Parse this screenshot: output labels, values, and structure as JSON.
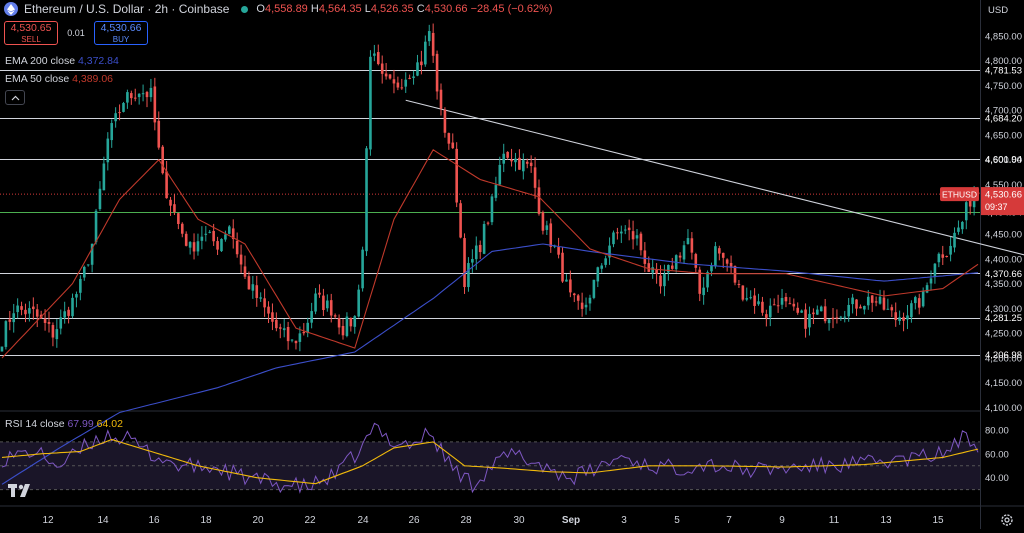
{
  "header": {
    "title": "Ethereum / U.S. Dollar · 2h · Coinbase",
    "open_label": "O",
    "open": "4,558.89",
    "high_label": "H",
    "high": "4,564.35",
    "low_label": "L",
    "low": "4,526.35",
    "close_label": "C",
    "close": "4,530.66",
    "change": "−28.45 (−0.62%)"
  },
  "trade": {
    "sell_price": "4,530.65",
    "sell_label": "SELL",
    "spread": "0.01",
    "buy_price": "4,530.66",
    "buy_label": "BUY"
  },
  "indicators": {
    "ema200_name": "EMA 200 close",
    "ema200_value": "4,372.84",
    "ema50_name": "EMA 50 close",
    "ema50_value": "4,389.06",
    "rsi_name": "RSI 14 close",
    "rsi_value": "67.99",
    "rsi_ma_value": "64.02"
  },
  "currency": "USD",
  "ticker_tag": {
    "symbol": "ETHUSD",
    "price": "4,530.66",
    "countdown": "09:37"
  },
  "colors": {
    "up": "#26a69a",
    "down": "#ef5350",
    "ema200": "#3b4ec9",
    "ema50": "#c0392b",
    "rsi": "#7e57c2",
    "rsi_ma": "#f0b90b",
    "tag": "#d63a3a"
  },
  "chart_data": {
    "type": "candlestick",
    "y_ticks": [
      4100,
      4150,
      4200,
      4250,
      4300,
      4350,
      4400,
      4450,
      4500,
      4550,
      4600,
      4650,
      4700,
      4750,
      4800,
      4850
    ],
    "y_tick_labels": [
      "4,100.00",
      "4,150.00",
      "4,200.00",
      "4,250.00",
      "4,300.00",
      "4,350.00",
      "4,400.00",
      "4,450.00",
      "4,500.00",
      "4,550.00",
      "4,600.00",
      "4,650.00",
      "4,700.00",
      "4,750.00",
      "4,800.00",
      "4,850.00"
    ],
    "ylim": [
      4095,
      4890
    ],
    "x_labels": [
      "12",
      "14",
      "16",
      "18",
      "20",
      "22",
      "24",
      "26",
      "28",
      "30",
      "Sep",
      "3",
      "5",
      "7",
      "9",
      "11",
      "13",
      "15"
    ],
    "horizontal_levels": [
      {
        "value": 4781.53,
        "label": "4,781.53"
      },
      {
        "value": 4684.2,
        "label": "4,684.20"
      },
      {
        "value": 4601.94,
        "label": "4,601.94"
      },
      {
        "value": 4494.94,
        "label": "4,494.94"
      },
      {
        "value": 4370.66,
        "label": "4,370.66"
      },
      {
        "value": 4281.25,
        "label": "4,281.25"
      },
      {
        "value": 4206.98,
        "label": "4,206.98"
      }
    ],
    "price_anchors": [
      [
        0,
        4240
      ],
      [
        3,
        4300
      ],
      [
        8,
        4290
      ],
      [
        13,
        4250
      ],
      [
        17,
        4300
      ],
      [
        20,
        4345
      ],
      [
        23,
        4430
      ],
      [
        27,
        4640
      ],
      [
        31,
        4720
      ],
      [
        35,
        4740
      ],
      [
        38,
        4730
      ],
      [
        41,
        4560
      ],
      [
        45,
        4470
      ],
      [
        48,
        4420
      ],
      [
        51,
        4450
      ],
      [
        55,
        4430
      ],
      [
        58,
        4470
      ],
      [
        62,
        4360
      ],
      [
        66,
        4310
      ],
      [
        70,
        4260
      ],
      [
        74,
        4230
      ],
      [
        77,
        4255
      ],
      [
        80,
        4320
      ],
      [
        84,
        4300
      ],
      [
        87,
        4260
      ],
      [
        90,
        4280
      ],
      [
        92,
        4420
      ],
      [
        94,
        4820
      ],
      [
        97,
        4760
      ],
      [
        100,
        4745
      ],
      [
        103,
        4770
      ],
      [
        107,
        4800
      ],
      [
        109,
        4860
      ],
      [
        112,
        4690
      ],
      [
        115,
        4610
      ],
      [
        118,
        4360
      ],
      [
        122,
        4430
      ],
      [
        125,
        4510
      ],
      [
        128,
        4620
      ],
      [
        131,
        4600
      ],
      [
        135,
        4580
      ],
      [
        138,
        4470
      ],
      [
        141,
        4420
      ],
      [
        145,
        4320
      ],
      [
        148,
        4290
      ],
      [
        151,
        4350
      ],
      [
        155,
        4430
      ],
      [
        158,
        4460
      ],
      [
        162,
        4440
      ],
      [
        165,
        4380
      ],
      [
        168,
        4340
      ],
      [
        171,
        4390
      ],
      [
        175,
        4440
      ],
      [
        178,
        4330
      ],
      [
        182,
        4420
      ],
      [
        185,
        4390
      ],
      [
        188,
        4340
      ],
      [
        192,
        4315
      ],
      [
        195,
        4290
      ],
      [
        198,
        4320
      ],
      [
        201,
        4295
      ],
      [
        205,
        4275
      ],
      [
        208,
        4290
      ],
      [
        211,
        4290
      ],
      [
        215,
        4300
      ],
      [
        218,
        4310
      ],
      [
        222,
        4320
      ],
      [
        225,
        4300
      ],
      [
        228,
        4280
      ],
      [
        232,
        4300
      ],
      [
        235,
        4320
      ],
      [
        238,
        4400
      ],
      [
        241,
        4420
      ],
      [
        245,
        4475
      ],
      [
        247,
        4520
      ],
      [
        249,
        4550
      ]
    ],
    "ema200_anchors": [
      [
        0,
        3945
      ],
      [
        15,
        4020
      ],
      [
        30,
        4090
      ],
      [
        55,
        4140
      ],
      [
        70,
        4180
      ],
      [
        90,
        4212
      ],
      [
        110,
        4320
      ],
      [
        125,
        4415
      ],
      [
        138,
        4430
      ],
      [
        150,
        4415
      ],
      [
        175,
        4390
      ],
      [
        200,
        4375
      ],
      [
        225,
        4355
      ],
      [
        249,
        4372
      ]
    ],
    "ema50_anchors": [
      [
        0,
        4200
      ],
      [
        18,
        4350
      ],
      [
        30,
        4520
      ],
      [
        40,
        4600
      ],
      [
        50,
        4480
      ],
      [
        62,
        4430
      ],
      [
        75,
        4260
      ],
      [
        90,
        4220
      ],
      [
        100,
        4480
      ],
      [
        110,
        4620
      ],
      [
        122,
        4560
      ],
      [
        137,
        4525
      ],
      [
        150,
        4420
      ],
      [
        165,
        4380
      ],
      [
        180,
        4370
      ],
      [
        200,
        4370
      ],
      [
        225,
        4325
      ],
      [
        240,
        4340
      ],
      [
        249,
        4389
      ]
    ],
    "trendline": {
      "start": [
        103,
        4720
      ],
      "end": [
        280,
        4370
      ]
    },
    "rsi": {
      "ylim": [
        18,
        90
      ],
      "y_ticks": [
        40,
        60,
        80
      ],
      "y_tick_labels": [
        "40.00",
        "60.00",
        "80.00"
      ],
      "bands": [
        30,
        50,
        70
      ],
      "anchors": [
        [
          0,
          56
        ],
        [
          8,
          62
        ],
        [
          15,
          50
        ],
        [
          22,
          68
        ],
        [
          27,
          76
        ],
        [
          32,
          72
        ],
        [
          38,
          60
        ],
        [
          45,
          50
        ],
        [
          55,
          48
        ],
        [
          62,
          40
        ],
        [
          70,
          35
        ],
        [
          78,
          32
        ],
        [
          85,
          42
        ],
        [
          92,
          65
        ],
        [
          95,
          82
        ],
        [
          100,
          70
        ],
        [
          105,
          68
        ],
        [
          109,
          78
        ],
        [
          115,
          48
        ],
        [
          120,
          35
        ],
        [
          125,
          50
        ],
        [
          130,
          60
        ],
        [
          138,
          50
        ],
        [
          145,
          40
        ],
        [
          150,
          45
        ],
        [
          158,
          58
        ],
        [
          165,
          50
        ],
        [
          172,
          48
        ],
        [
          180,
          52
        ],
        [
          190,
          46
        ],
        [
          200,
          48
        ],
        [
          210,
          50
        ],
        [
          220,
          52
        ],
        [
          230,
          55
        ],
        [
          240,
          60
        ],
        [
          245,
          73
        ],
        [
          249,
          68
        ]
      ],
      "ma_anchors": [
        [
          0,
          57
        ],
        [
          10,
          60
        ],
        [
          20,
          62
        ],
        [
          28,
          72
        ],
        [
          38,
          62
        ],
        [
          50,
          50
        ],
        [
          65,
          40
        ],
        [
          80,
          35
        ],
        [
          92,
          50
        ],
        [
          100,
          65
        ],
        [
          110,
          70
        ],
        [
          118,
          50
        ],
        [
          128,
          48
        ],
        [
          140,
          45
        ],
        [
          150,
          44
        ],
        [
          165,
          50
        ],
        [
          180,
          50
        ],
        [
          200,
          49
        ],
        [
          220,
          51
        ],
        [
          240,
          57
        ],
        [
          249,
          64
        ]
      ]
    }
  }
}
